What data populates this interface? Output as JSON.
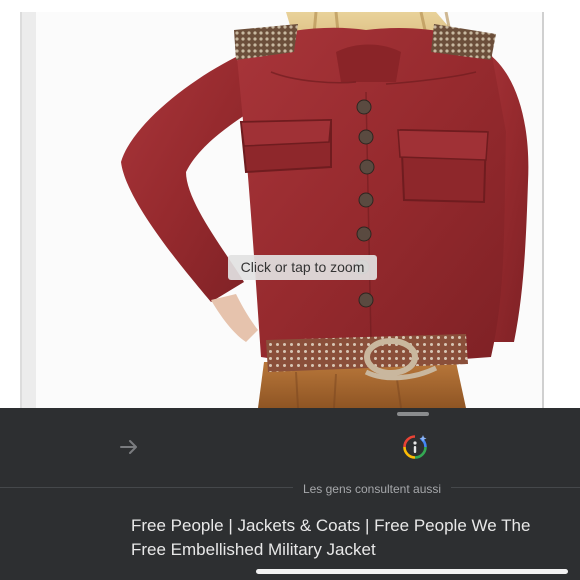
{
  "viewer": {
    "zoom_hint": "Click or tap to zoom",
    "image_subject": "red embellished military jacket"
  },
  "sheet": {
    "arrow_icon": "arrow-right-icon",
    "lens_icon": "google-lens-icon",
    "section_label": "Les gens consultent aussi",
    "result_title": "Free People | Jackets & Coats | Free People We The Free Embellished Military Jacket"
  },
  "colors": {
    "sheet_background": "#2d2f31",
    "jacket_red": "#9c2b2e",
    "text_light": "#e8e8e8",
    "label_gray": "#a6a8ab"
  }
}
